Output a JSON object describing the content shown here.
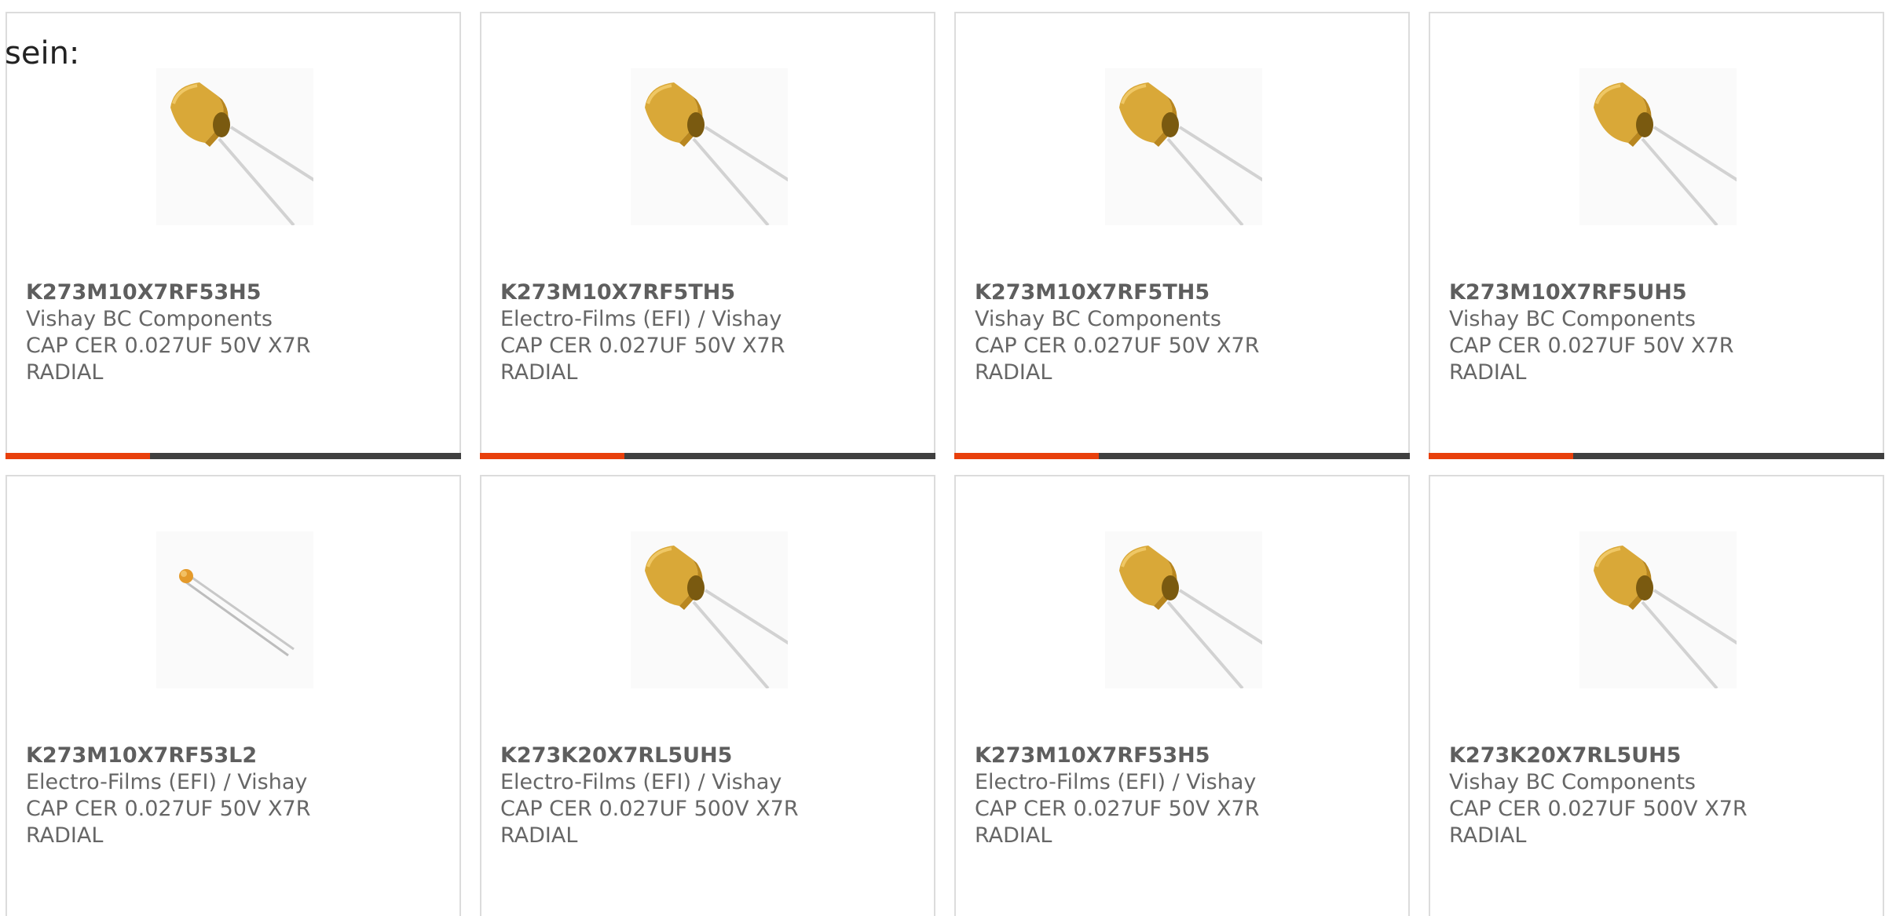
{
  "heading": "sein:",
  "colors": {
    "accent": "#e8400c",
    "bar_dark": "#404040",
    "border": "#dcdcdc",
    "text": "#666666"
  },
  "cards": [
    {
      "part_number": "K273M10X7RF53H5",
      "manufacturer": "Vishay BC Components",
      "description_line1": "CAP CER 0.027UF 50V X7R",
      "description_line2": "RADIAL",
      "image": "yellow-radial-capacitor-large",
      "has_bar": true
    },
    {
      "part_number": "K273M10X7RF5TH5",
      "manufacturer": "Electro-Films (EFI) / Vishay",
      "description_line1": "CAP CER 0.027UF 50V X7R",
      "description_line2": "RADIAL",
      "image": "yellow-radial-capacitor-large",
      "has_bar": true
    },
    {
      "part_number": "K273M10X7RF5TH5",
      "manufacturer": "Vishay BC Components",
      "description_line1": "CAP CER 0.027UF 50V X7R",
      "description_line2": "RADIAL",
      "image": "yellow-radial-capacitor-large",
      "has_bar": true
    },
    {
      "part_number": "K273M10X7RF5UH5",
      "manufacturer": "Vishay BC Components",
      "description_line1": "CAP CER 0.027UF 50V X7R",
      "description_line2": "RADIAL",
      "image": "yellow-radial-capacitor-large",
      "has_bar": true
    },
    {
      "part_number": "K273M10X7RF53L2",
      "manufacturer": "Electro-Films (EFI) / Vishay",
      "description_line1": "CAP CER 0.027UF 50V X7R",
      "description_line2": "RADIAL",
      "image": "orange-radial-capacitor-small",
      "has_bar": false
    },
    {
      "part_number": "K273K20X7RL5UH5",
      "manufacturer": "Electro-Films (EFI) / Vishay",
      "description_line1": "CAP CER 0.027UF 500V X7R",
      "description_line2": "RADIAL",
      "image": "yellow-radial-capacitor-large",
      "has_bar": false
    },
    {
      "part_number": "K273M10X7RF53H5",
      "manufacturer": "Electro-Films (EFI) / Vishay",
      "description_line1": "CAP CER 0.027UF 50V X7R",
      "description_line2": "RADIAL",
      "image": "yellow-radial-capacitor-large",
      "has_bar": false
    },
    {
      "part_number": "K273K20X7RL5UH5",
      "manufacturer": "Vishay BC Components",
      "description_line1": "CAP CER 0.027UF 500V X7R",
      "description_line2": "RADIAL",
      "image": "yellow-radial-capacitor-large",
      "has_bar": false
    }
  ]
}
